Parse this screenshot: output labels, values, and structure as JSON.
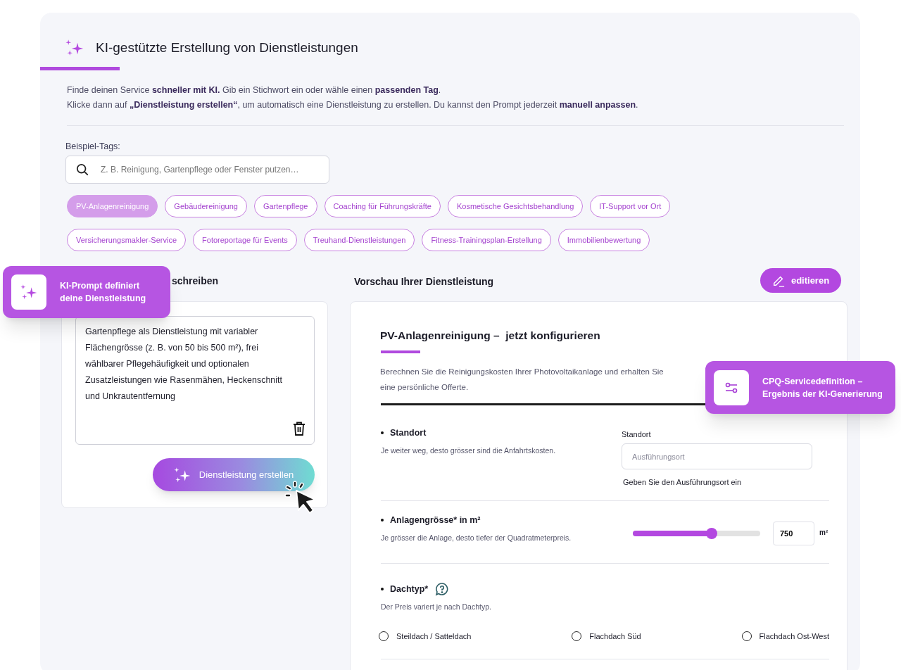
{
  "header": {
    "title": "KI-gestützte Erstellung von Dienstleistungen"
  },
  "intro": [
    "Finde deinen Service **schneller mit KI.** Gib ein Stichwort ein oder wähle einen **passenden Tag**.",
    "Klicke dann auf **„Dienstleistung erstellen“**, um automatisch eine Dienstleistung zu erstellen. Du kannst den Prompt jederzeit **manuell anpassen**."
  ],
  "tags_label": "Beispiel-Tags:",
  "search": {
    "placeholder": "Z. B. Reinigung, Gartenpflege oder Fenster putzen…"
  },
  "tags": [
    {
      "label": "PV-Anlagenreinigung",
      "selected": true
    },
    {
      "label": "Gebäudereinigung",
      "selected": false
    },
    {
      "label": "Gartenpflege",
      "selected": false
    },
    {
      "label": "Coaching für Führungskräfte",
      "selected": false
    },
    {
      "label": "Kosmetische Gesichtsbehandlung",
      "selected": false
    },
    {
      "label": "IT-Support vor Ort",
      "selected": false
    },
    {
      "label": "Versicherungsmakler-Service",
      "selected": false
    },
    {
      "label": "Fotoreportage für Events",
      "selected": false
    },
    {
      "label": "Treuhand-Dienstleistungen",
      "selected": false
    },
    {
      "label": "Fitness-Trainingsplan-Erstellung",
      "selected": false
    },
    {
      "label": "Immobilienbewertung",
      "selected": false
    }
  ],
  "describe": {
    "heading": "schreiben",
    "prompt": "Gartenpflege als Dienstleistung mit variabler Flächengrösse (z. B. von 50 bis 500 m²), frei wählbarer Pflegehäufigkeit und optionalen Zusatzleistungen wie Rasenmähen, Heckenschnitt und Unkrautentfernung",
    "create_button": "Dienstleistung erstellen"
  },
  "preview": {
    "heading": "Vorschau Ihrer Dienstleistung",
    "edit_button": "editieren",
    "title": "PV-Anlagenreinigung –  jetzt konfigurieren",
    "description": [
      "Berechnen Sie die Reinigungskosten Ihrer Photovoltaikanlage und erhalten Sie",
      "eine persönliche Offerte."
    ],
    "fields": [
      {
        "kind": "text",
        "label": "Standort",
        "hint": "Je weiter weg, desto grösser sind die Anfahrtskosten.",
        "field_label": "Standort",
        "placeholder": "Ausführungsort",
        "help": "Geben Sie den Ausführungsort ein"
      },
      {
        "kind": "slider",
        "label": "Anlagengrösse* in m²",
        "hint": "Je grösser die Anlage, desto tiefer der Quadratmeterpreis.",
        "level": 0.62,
        "value": "750",
        "unit": "m²"
      },
      {
        "kind": "radio",
        "label": "Dachtyp*",
        "help_icon": true,
        "hint": "Der Preis variert je nach Dachtyp.",
        "options": [
          {
            "label": "Steildach / Satteldach",
            "selected": false
          },
          {
            "label": "Flachdach Süd",
            "selected": false
          },
          {
            "label": "Flachdach Ost-West",
            "selected": false
          }
        ]
      }
    ]
  },
  "callouts": [
    {
      "kind": "sparkles",
      "text": "KI-Prompt definiert deine Dienstleistung"
    },
    {
      "kind": "sliders",
      "text": "CPQ-Servicedefinition – Ergebnis der KI-Generierung"
    }
  ]
}
